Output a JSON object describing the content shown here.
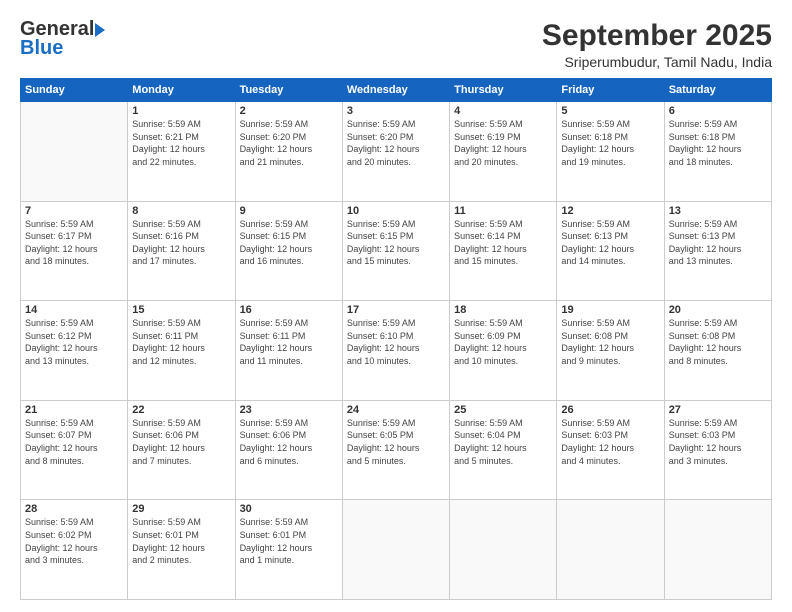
{
  "logo": {
    "general": "General",
    "blue": "Blue"
  },
  "title": "September 2025",
  "location": "Sriperumbudur, Tamil Nadu, India",
  "days_of_week": [
    "Sunday",
    "Monday",
    "Tuesday",
    "Wednesday",
    "Thursday",
    "Friday",
    "Saturday"
  ],
  "weeks": [
    [
      {
        "day": "",
        "info": ""
      },
      {
        "day": "1",
        "info": "Sunrise: 5:59 AM\nSunset: 6:21 PM\nDaylight: 12 hours\nand 22 minutes."
      },
      {
        "day": "2",
        "info": "Sunrise: 5:59 AM\nSunset: 6:20 PM\nDaylight: 12 hours\nand 21 minutes."
      },
      {
        "day": "3",
        "info": "Sunrise: 5:59 AM\nSunset: 6:20 PM\nDaylight: 12 hours\nand 20 minutes."
      },
      {
        "day": "4",
        "info": "Sunrise: 5:59 AM\nSunset: 6:19 PM\nDaylight: 12 hours\nand 20 minutes."
      },
      {
        "day": "5",
        "info": "Sunrise: 5:59 AM\nSunset: 6:18 PM\nDaylight: 12 hours\nand 19 minutes."
      },
      {
        "day": "6",
        "info": "Sunrise: 5:59 AM\nSunset: 6:18 PM\nDaylight: 12 hours\nand 18 minutes."
      }
    ],
    [
      {
        "day": "7",
        "info": "Sunrise: 5:59 AM\nSunset: 6:17 PM\nDaylight: 12 hours\nand 18 minutes."
      },
      {
        "day": "8",
        "info": "Sunrise: 5:59 AM\nSunset: 6:16 PM\nDaylight: 12 hours\nand 17 minutes."
      },
      {
        "day": "9",
        "info": "Sunrise: 5:59 AM\nSunset: 6:15 PM\nDaylight: 12 hours\nand 16 minutes."
      },
      {
        "day": "10",
        "info": "Sunrise: 5:59 AM\nSunset: 6:15 PM\nDaylight: 12 hours\nand 15 minutes."
      },
      {
        "day": "11",
        "info": "Sunrise: 5:59 AM\nSunset: 6:14 PM\nDaylight: 12 hours\nand 15 minutes."
      },
      {
        "day": "12",
        "info": "Sunrise: 5:59 AM\nSunset: 6:13 PM\nDaylight: 12 hours\nand 14 minutes."
      },
      {
        "day": "13",
        "info": "Sunrise: 5:59 AM\nSunset: 6:13 PM\nDaylight: 12 hours\nand 13 minutes."
      }
    ],
    [
      {
        "day": "14",
        "info": "Sunrise: 5:59 AM\nSunset: 6:12 PM\nDaylight: 12 hours\nand 13 minutes."
      },
      {
        "day": "15",
        "info": "Sunrise: 5:59 AM\nSunset: 6:11 PM\nDaylight: 12 hours\nand 12 minutes."
      },
      {
        "day": "16",
        "info": "Sunrise: 5:59 AM\nSunset: 6:11 PM\nDaylight: 12 hours\nand 11 minutes."
      },
      {
        "day": "17",
        "info": "Sunrise: 5:59 AM\nSunset: 6:10 PM\nDaylight: 12 hours\nand 10 minutes."
      },
      {
        "day": "18",
        "info": "Sunrise: 5:59 AM\nSunset: 6:09 PM\nDaylight: 12 hours\nand 10 minutes."
      },
      {
        "day": "19",
        "info": "Sunrise: 5:59 AM\nSunset: 6:08 PM\nDaylight: 12 hours\nand 9 minutes."
      },
      {
        "day": "20",
        "info": "Sunrise: 5:59 AM\nSunset: 6:08 PM\nDaylight: 12 hours\nand 8 minutes."
      }
    ],
    [
      {
        "day": "21",
        "info": "Sunrise: 5:59 AM\nSunset: 6:07 PM\nDaylight: 12 hours\nand 8 minutes."
      },
      {
        "day": "22",
        "info": "Sunrise: 5:59 AM\nSunset: 6:06 PM\nDaylight: 12 hours\nand 7 minutes."
      },
      {
        "day": "23",
        "info": "Sunrise: 5:59 AM\nSunset: 6:06 PM\nDaylight: 12 hours\nand 6 minutes."
      },
      {
        "day": "24",
        "info": "Sunrise: 5:59 AM\nSunset: 6:05 PM\nDaylight: 12 hours\nand 5 minutes."
      },
      {
        "day": "25",
        "info": "Sunrise: 5:59 AM\nSunset: 6:04 PM\nDaylight: 12 hours\nand 5 minutes."
      },
      {
        "day": "26",
        "info": "Sunrise: 5:59 AM\nSunset: 6:03 PM\nDaylight: 12 hours\nand 4 minutes."
      },
      {
        "day": "27",
        "info": "Sunrise: 5:59 AM\nSunset: 6:03 PM\nDaylight: 12 hours\nand 3 minutes."
      }
    ],
    [
      {
        "day": "28",
        "info": "Sunrise: 5:59 AM\nSunset: 6:02 PM\nDaylight: 12 hours\nand 3 minutes."
      },
      {
        "day": "29",
        "info": "Sunrise: 5:59 AM\nSunset: 6:01 PM\nDaylight: 12 hours\nand 2 minutes."
      },
      {
        "day": "30",
        "info": "Sunrise: 5:59 AM\nSunset: 6:01 PM\nDaylight: 12 hours\nand 1 minute."
      },
      {
        "day": "",
        "info": ""
      },
      {
        "day": "",
        "info": ""
      },
      {
        "day": "",
        "info": ""
      },
      {
        "day": "",
        "info": ""
      }
    ]
  ]
}
